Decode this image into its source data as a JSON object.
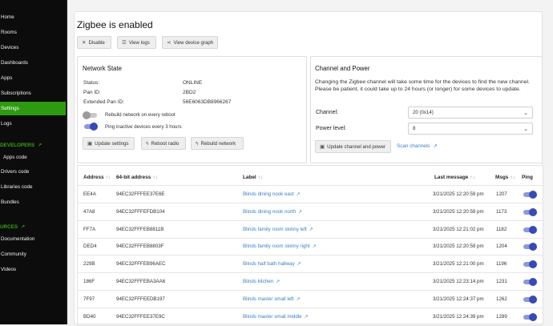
{
  "sidebar": {
    "header_fragment": "",
    "items": [
      {
        "label": "Home",
        "active": false
      },
      {
        "label": "Rooms",
        "active": false
      },
      {
        "label": "Devices",
        "active": false
      },
      {
        "label": "Dashboards",
        "active": false
      },
      {
        "label": "Apps",
        "active": false
      },
      {
        "label": "Subscriptions",
        "active": false
      },
      {
        "label": "Settings",
        "active": true
      },
      {
        "label": "Logs",
        "active": false
      }
    ],
    "developers_title": "DEVELOPERS",
    "developer_items": [
      "Apps code",
      "Drivers code",
      "Libraries code",
      "Bundles"
    ],
    "resources_title": "URCES",
    "resource_items": [
      "Documentation",
      "Community",
      "Videos"
    ]
  },
  "page": {
    "title": "Zigbee is enabled",
    "buttons": {
      "disable": "Disable",
      "view_logs": "View logs",
      "view_device_graph": "View device graph"
    }
  },
  "network_state": {
    "title": "Network State",
    "status_label": "Status:",
    "status_value": "ONLINE",
    "pan_label": "Pan ID:",
    "pan_value": "2BD2",
    "ext_pan_label": "Extended Pan ID:",
    "ext_pan_value": "56E6063DB8966267",
    "rebuild_toggle_label": "Rebuild network on every reboot",
    "rebuild_toggle_on": false,
    "ping_toggle_label": "Ping inactive devices every 3 hours",
    "ping_toggle_on": true,
    "buttons": {
      "update_settings": "Update settings",
      "reboot_radio": "Reboot radio",
      "rebuild_network": "Rebuild network"
    }
  },
  "channel_power": {
    "title": "Channel and Power",
    "note": "Changing the Zigbee channel will take some time for the devices to find the new channel. Please be patient, it could take up to 24 hours (or longer) for some devices to update.",
    "channel_label": "Channel:",
    "channel_value": "20 (0x14)",
    "power_label": "Power level:",
    "power_value": "8",
    "update_button": "Update channel and power",
    "scan_link": "Scan channels"
  },
  "table": {
    "headers": {
      "address": "Address",
      "ieee": "64-bit address",
      "label": "Label",
      "last_message": "Last message",
      "msgs": "Msgs",
      "ping": "Ping"
    },
    "rows": [
      {
        "address": "EE4A",
        "ieee": "94EC32FFFEE37E6E",
        "label": "Blinds dining nook east",
        "last": "3/21/2025 12:20:59 pm",
        "msgs": "1207",
        "ping": true
      },
      {
        "address": "47A8",
        "ieee": "94EC32FFFEFDB104",
        "label": "Blinds dining nook north",
        "last": "3/21/2025 12:20:59 pm",
        "msgs": "1173",
        "ping": true
      },
      {
        "address": "FF7A",
        "ieee": "94EC32FFFEB8811B",
        "label": "Blinds family room skinny left",
        "last": "3/21/2025 12:21:02 pm",
        "msgs": "1182",
        "ping": true
      },
      {
        "address": "DED4",
        "ieee": "94EC32FFFEB8803F",
        "label": "Blinds family room skinny right",
        "last": "3/21/2025 12:20:59 pm",
        "msgs": "1204",
        "ping": true
      },
      {
        "address": "229B",
        "ieee": "94EC32FFFEB96AEC",
        "label": "Blinds half bath hallway",
        "last": "3/21/2025 12:21:00 pm",
        "msgs": "1196",
        "ping": true
      },
      {
        "address": "186F",
        "ieee": "94EC32FFFEBA3AA6",
        "label": "Blinds kitchen",
        "last": "3/21/2025 12:23:14 pm",
        "msgs": "1231",
        "ping": true
      },
      {
        "address": "7F97",
        "ieee": "94EC32FFFEEDB197",
        "label": "Blinds master small left",
        "last": "3/21/2025 12:24:37 pm",
        "msgs": "1262",
        "ping": true
      },
      {
        "address": "BD40",
        "ieee": "94EC32FFFEE37E9C",
        "label": "Blinds master small middle",
        "last": "3/21/2025 12:24:39 pm",
        "msgs": "1289",
        "ping": true
      }
    ]
  },
  "colors": {
    "accent_green": "#2e9a11",
    "link_blue": "#3b7fc4",
    "toggle_blue": "#3849b8"
  }
}
